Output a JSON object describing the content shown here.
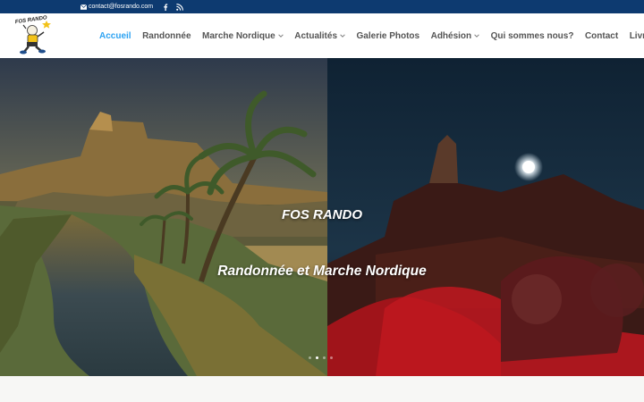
{
  "topbar": {
    "email": "contact@fosrando.com",
    "email_icon": "envelope-icon",
    "social": [
      "facebook-icon",
      "rss-icon"
    ]
  },
  "logo": {
    "text": "FOS RANDO"
  },
  "nav": {
    "items": [
      {
        "label": "Accueil",
        "active": true,
        "dropdown": false
      },
      {
        "label": "Randonnée",
        "active": false,
        "dropdown": false
      },
      {
        "label": "Marche Nordique",
        "active": false,
        "dropdown": true
      },
      {
        "label": "Actualités",
        "active": false,
        "dropdown": true
      },
      {
        "label": "Galerie Photos",
        "active": false,
        "dropdown": false
      },
      {
        "label": "Adhésion",
        "active": false,
        "dropdown": true
      },
      {
        "label": "Qui sommes nous?",
        "active": false,
        "dropdown": false
      },
      {
        "label": "Contact",
        "active": false,
        "dropdown": false
      },
      {
        "label": "Livre d'or",
        "active": false,
        "dropdown": false
      }
    ]
  },
  "hero": {
    "title": "FOS RANDO",
    "subtitle": "Randonnée et Marche Nordique",
    "slides": 4,
    "active_slide": 2
  },
  "colors": {
    "topbar": "#0d3a70",
    "accent": "#2ea3f2",
    "nav_text": "#555555"
  }
}
